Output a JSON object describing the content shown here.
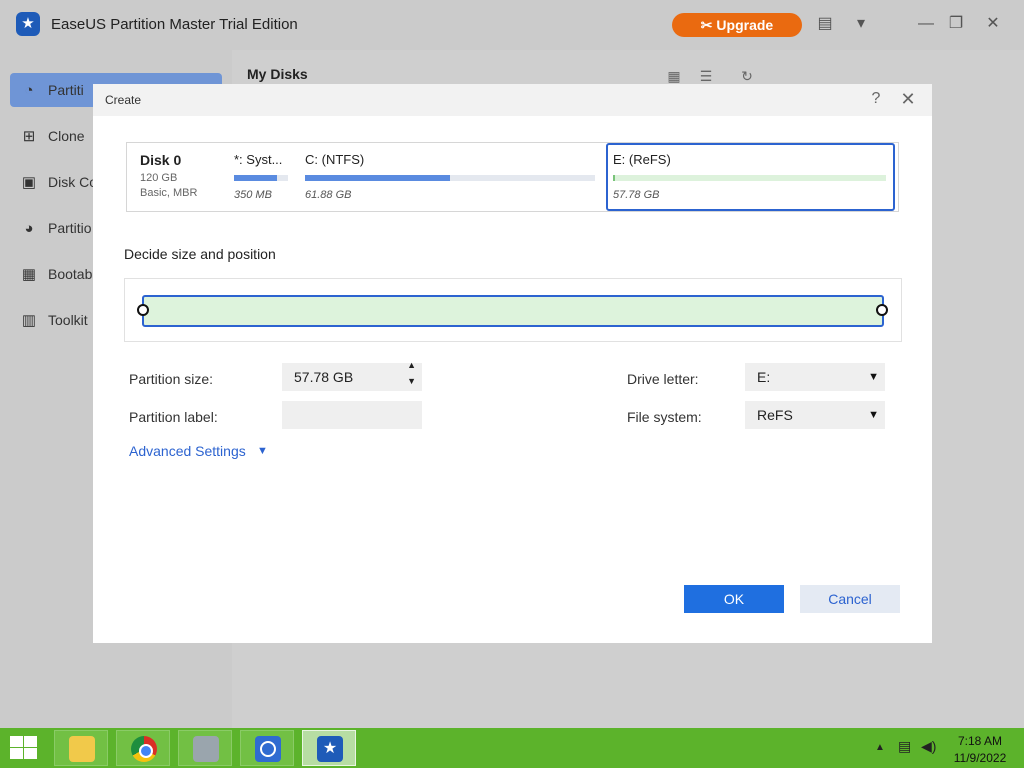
{
  "app": {
    "title": "EaseUS Partition Master Trial Edition",
    "upgrade_label": "Upgrade",
    "icons": [
      "feedback-icon",
      "menu-icon",
      "minimize-icon",
      "restore-icon",
      "close-icon"
    ]
  },
  "sidebar": {
    "items": [
      {
        "label": "Partiti",
        "icon": "pie-chart-icon",
        "active": true
      },
      {
        "label": "Clone",
        "icon": "clone-icon"
      },
      {
        "label": "Disk Co",
        "icon": "disk-icon"
      },
      {
        "label": "Partitio",
        "icon": "partition-recovery-icon"
      },
      {
        "label": "Bootab",
        "icon": "usb-icon"
      },
      {
        "label": "Toolkit",
        "icon": "toolkit-icon"
      }
    ]
  },
  "main": {
    "heading": "My Disks"
  },
  "dialog": {
    "title": "Create",
    "disk": {
      "name": "Disk 0",
      "size": "120 GB",
      "type": "Basic, MBR",
      "partitions": [
        {
          "name": "*: Syst...",
          "size": "350 MB",
          "used_fraction": 0.8
        },
        {
          "name": "C: (NTFS)",
          "size": "61.88 GB",
          "used_fraction": 0.5
        },
        {
          "name": "E: (ReFS)",
          "size": "57.78 GB",
          "used_fraction": 0.01,
          "selected": true
        }
      ]
    },
    "decide_label": "Decide size and position",
    "fields": {
      "partition_size_label": "Partition size:",
      "partition_size_value": "57.78 GB",
      "partition_label_label": "Partition label:",
      "partition_label_value": "",
      "drive_letter_label": "Drive letter:",
      "drive_letter_value": "E:",
      "file_system_label": "File system:",
      "file_system_value": "ReFS"
    },
    "advanced_settings": "Advanced Settings",
    "ok_label": "OK",
    "cancel_label": "Cancel"
  },
  "taskbar": {
    "apps": [
      "file-explorer-icon",
      "chrome-icon",
      "drive-icon",
      "app-icon",
      "easeus-icon"
    ],
    "time": "7:18 AM",
    "date": "11/9/2022"
  },
  "colors": {
    "accent": "#2c63d0",
    "upgrade": "#ea6a10",
    "taskbar": "#5cb32b"
  }
}
